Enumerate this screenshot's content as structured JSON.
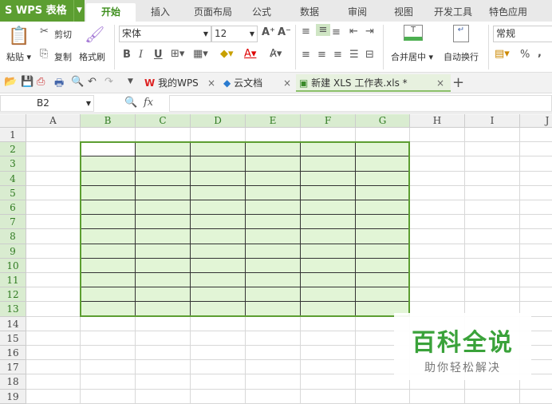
{
  "app": {
    "logo": "WPS 表格"
  },
  "ribbon_tabs": [
    "开始",
    "插入",
    "页面布局",
    "公式",
    "数据",
    "审阅",
    "视图",
    "开发工具",
    "特色应用"
  ],
  "active_tab": 0,
  "clipboard": {
    "paste": "粘贴",
    "cut": "剪切",
    "copy": "复制",
    "format_painter": "格式刷"
  },
  "font": {
    "name": "宋体",
    "size": "12",
    "bold": "B",
    "italic": "I",
    "underline": "U"
  },
  "alignment": {
    "merge_center": "合并居中",
    "wrap_text": "自动换行"
  },
  "number": {
    "format": "常规",
    "percent": "%"
  },
  "doc_tabs": [
    {
      "label": "我的WPS"
    },
    {
      "label": "云文档"
    },
    {
      "label": "新建 XLS 工作表.xls *",
      "active": true
    }
  ],
  "formula_bar": {
    "name_box": "B2",
    "fx": "fx",
    "value": ""
  },
  "columns": [
    "A",
    "B",
    "C",
    "D",
    "E",
    "F",
    "G",
    "H",
    "I",
    "J"
  ],
  "rows": [
    "1",
    "2",
    "3",
    "4",
    "5",
    "6",
    "7",
    "8",
    "9",
    "10",
    "11",
    "12",
    "13",
    "14",
    "15",
    "16",
    "17",
    "18",
    "19"
  ],
  "selection": {
    "range": "B2:G13",
    "fill": "#e2f5d6",
    "border": "#5c9e31"
  },
  "watermark": {
    "title": "百科全说",
    "subtitle": "助你轻松解决"
  }
}
